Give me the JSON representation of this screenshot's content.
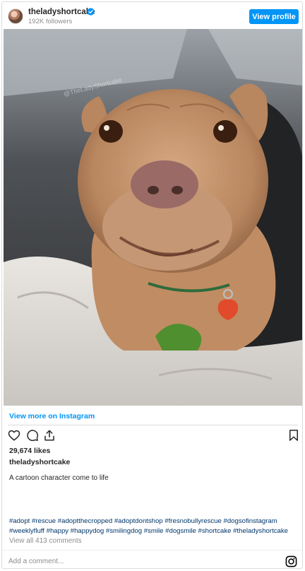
{
  "header": {
    "username": "theladyshortcake",
    "followers": "192K followers",
    "view_profile_label": "View profile",
    "avatar_icon": "profile-photo-icon",
    "verified_icon": "verified-badge-icon"
  },
  "photo": {
    "watermark": "@TheLadyShortcake"
  },
  "links": {
    "view_more": "View more on Instagram"
  },
  "actions": {
    "icons": [
      "heart-icon",
      "comment-icon",
      "share-icon",
      "bookmark-icon"
    ]
  },
  "post": {
    "likes": "29,674 likes",
    "caption_username": "theladyshortcake",
    "caption": "A cartoon character come to life",
    "hashtags_line1": "#adopt #rescue #adoptthecropped #adoptdontshop #fresnobullyrescue #dogsofinstagram",
    "hashtags_line2": "#weeklyfluff #happy #happydog #smilingdog #smile #dogsmile #shortcake #theladyshortcake",
    "view_all_comments": "View all 413 comments"
  },
  "comment": {
    "placeholder": "Add a comment...",
    "icon": "instagram-logo-icon"
  },
  "colors": {
    "accent": "#0095f6",
    "hashtag": "#00376b",
    "muted": "#8e8e8e"
  }
}
